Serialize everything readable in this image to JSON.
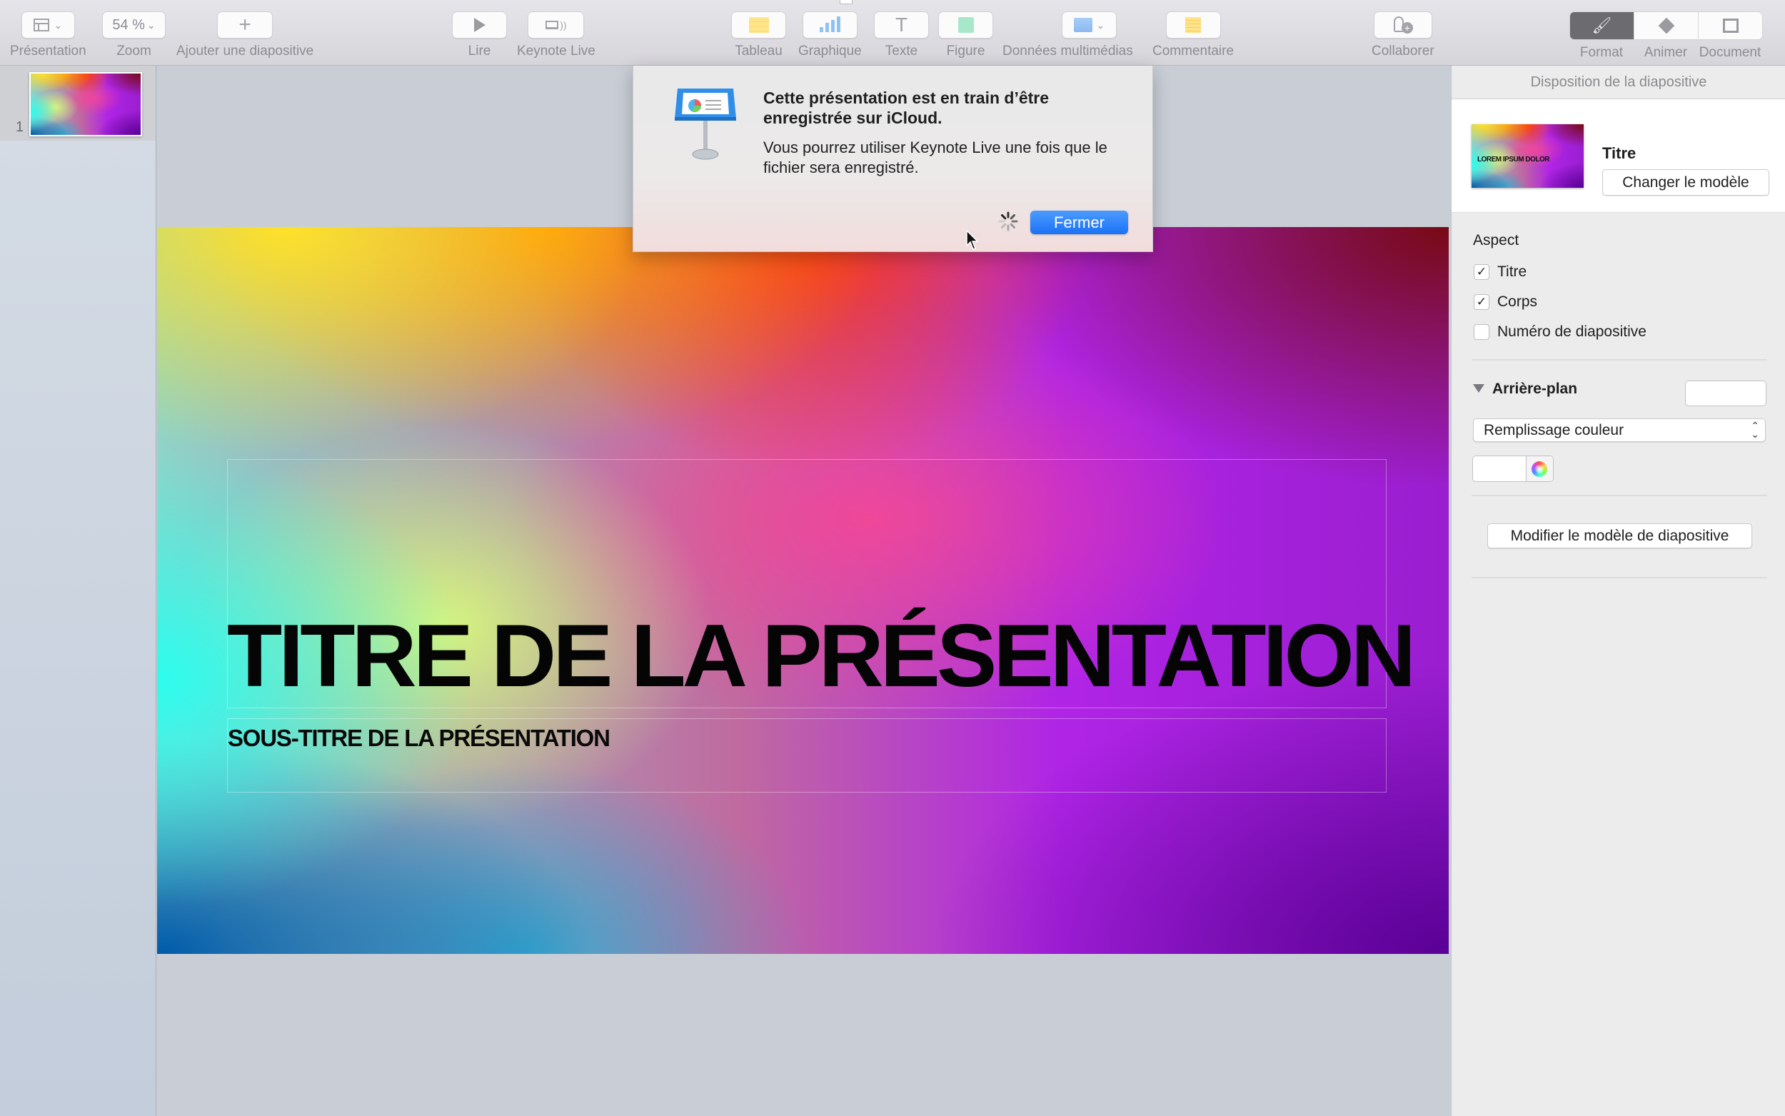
{
  "toolbar": {
    "items": [
      {
        "id": "presentation",
        "label": "Présentation",
        "icon": "view-layout-icon"
      },
      {
        "id": "zoom",
        "label": "Zoom",
        "value": "54 %"
      },
      {
        "id": "add-slide",
        "label": "Ajouter une diapositive",
        "icon": "plus-icon"
      },
      {
        "id": "play",
        "label": "Lire",
        "icon": "play-icon"
      },
      {
        "id": "keynote-live",
        "label": "Keynote Live",
        "icon": "keynote-live-icon"
      },
      {
        "id": "table",
        "label": "Tableau",
        "icon": "table-icon"
      },
      {
        "id": "chart",
        "label": "Graphique",
        "icon": "chart-icon"
      },
      {
        "id": "text",
        "label": "Texte",
        "icon": "text-icon"
      },
      {
        "id": "shape",
        "label": "Figure",
        "icon": "shape-icon"
      },
      {
        "id": "media",
        "label": "Données multimédias",
        "icon": "media-icon"
      },
      {
        "id": "comment",
        "label": "Commentaire",
        "icon": "comment-icon"
      },
      {
        "id": "collaborate",
        "label": "Collaborer",
        "icon": "collaborate-icon"
      }
    ],
    "inspector_tabs": [
      {
        "label": "Format",
        "icon": "paintbrush-icon",
        "selected": true
      },
      {
        "label": "Animer",
        "icon": "animate-diamond-icon",
        "selected": false
      },
      {
        "label": "Document",
        "icon": "document-icon",
        "selected": false
      }
    ]
  },
  "navigator": {
    "slides": [
      {
        "number": "1",
        "selected": true
      }
    ]
  },
  "slide": {
    "title": "TITRE DE LA PRÉSENTATION",
    "subtitle": "SOUS-TITRE DE LA PRÉSENTATION"
  },
  "dialog": {
    "title": "Cette présentation est en train d’être enregistrée sur iCloud.",
    "message": "Vous pourrez utiliser Keynote Live une fois que le fichier sera enregistré.",
    "close_button": "Fermer",
    "icon": "keynote-app-icon",
    "accent": "#1a72f5"
  },
  "inspector": {
    "header": "Disposition de la diapositive",
    "master": {
      "name": "Titre",
      "thumb_text": "LOREM IPSUM DOLOR",
      "change_button": "Changer le modèle"
    },
    "aspect": {
      "title": "Aspect",
      "options": [
        {
          "label": "Titre",
          "checked": true
        },
        {
          "label": "Corps",
          "checked": true
        },
        {
          "label": "Numéro de diapositive",
          "checked": false
        }
      ]
    },
    "background": {
      "title": "Arrière-plan",
      "fill_type": "Remplissage couleur",
      "color": "#ffffff"
    },
    "edit_master_button": "Modifier le modèle de diapositive"
  }
}
